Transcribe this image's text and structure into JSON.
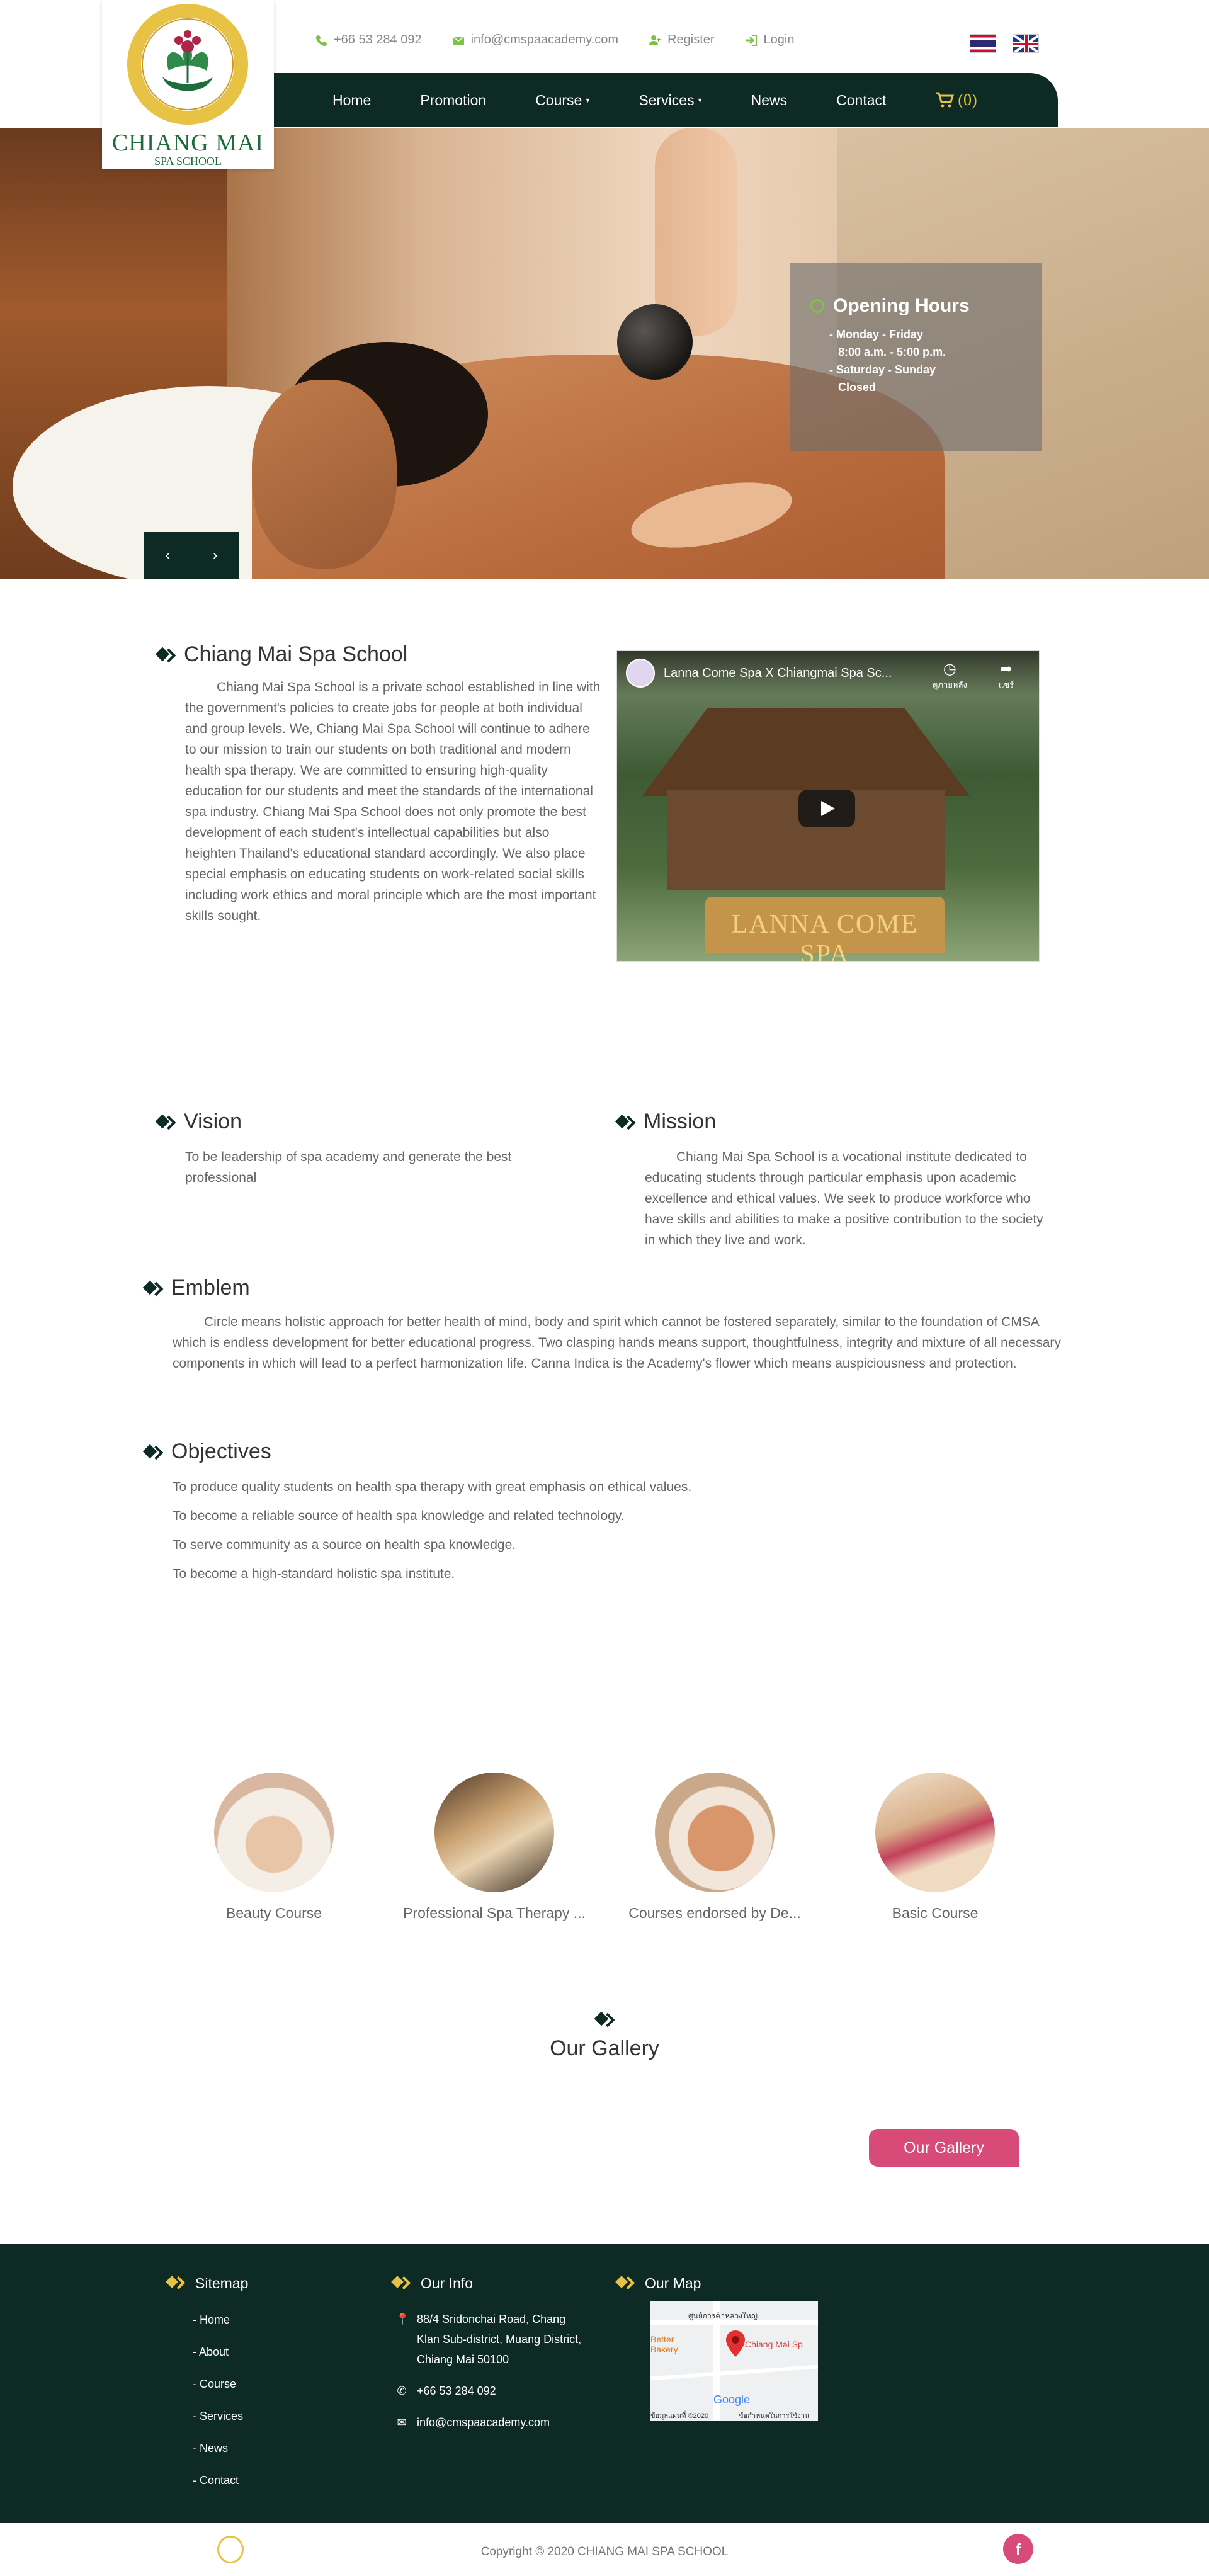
{
  "topbar": {
    "phone": "+66 53 284 092",
    "email": "info@cmspaacademy.com",
    "register": "Register",
    "login": "Login",
    "flags": [
      "thai-flag-icon",
      "uk-flag-icon"
    ]
  },
  "logo": {
    "arc_text": "โรงเรียนสปาเชียงใหม่ · CHIANG MAI SPA SCHOOL",
    "title": "CHIANG MAI",
    "subtitle": "SPA SCHOOL"
  },
  "nav": {
    "items": [
      {
        "label": "Home",
        "caret": false
      },
      {
        "label": "Promotion",
        "caret": false
      },
      {
        "label": "Course",
        "caret": true
      },
      {
        "label": "Services",
        "caret": true
      },
      {
        "label": "News",
        "caret": false
      },
      {
        "label": "Contact",
        "caret": false
      }
    ],
    "cart_count": "(0)"
  },
  "hero": {
    "hours_title": "Opening Hours",
    "hours": [
      "- Monday - Friday",
      "8:00 a.m. - 5:00 p.m.",
      "- Saturday - Sunday",
      "Closed"
    ],
    "prev": "‹",
    "next": "›"
  },
  "about": {
    "title": "Chiang Mai Spa School",
    "text": "Chiang Mai Spa School is a private school established in line with the government's policies to create jobs for people at both individual and group levels. We, Chiang Mai Spa School will continue to adhere to our mission to train our students on both traditional and modern health spa therapy. We are committed to ensuring high-quality education for our students and meet the standards of the international spa industry. Chiang Mai Spa School does not only promote the best development of each student's intellectual capabilities but also heighten Thailand's educational standard accordingly. We also place special emphasis on educating students on work-related social skills including work ethics and moral principle which are the most important skills sought.",
    "video_title": "Lanna Come Spa X Chiangmai Spa Sc...",
    "video_sign": "LANNA COME SPA",
    "video_watch_later": "ดูภายหลัง",
    "video_share": "แชร์"
  },
  "vision": {
    "title": "Vision",
    "text": "To be leadership of spa academy and generate the best professional"
  },
  "mission": {
    "title": "Mission",
    "text": "Chiang Mai Spa School is a vocational institute dedicated to educating students through particular emphasis upon academic excellence and ethical values. We seek to produce workforce who have skills and abilities to make a positive contribution to the society in which they live and work."
  },
  "emblem": {
    "title": "Emblem",
    "text": "Circle means holistic approach for better health of mind, body and spirit which cannot be fostered separately, similar to the foundation of CMSA which is endless development for better educational progress. Two clasping hands means support, thoughtfulness, integrity and mixture of all necessary components in which will lead to a perfect harmonization life. Canna Indica is the Academy's flower which means auspiciousness and protection."
  },
  "objectives": {
    "title": "Objectives",
    "items": [
      "To produce quality students on health spa therapy with great emphasis on ethical values.",
      "To become a reliable source of health spa knowledge and related technology.",
      "To serve community as a source on health spa knowledge.",
      "To become a high-standard holistic spa institute."
    ]
  },
  "courses": [
    {
      "label": "Beauty Course"
    },
    {
      "label": "Professional Spa Therapy ..."
    },
    {
      "label": "Courses endorsed by De..."
    },
    {
      "label": "Basic Course"
    }
  ],
  "gallery": {
    "title": "Our Gallery",
    "button": "Our Gallery"
  },
  "footer": {
    "sitemap_title": "Sitemap",
    "sitemap": [
      "- Home",
      "- About",
      "- Course",
      "- Services",
      "- News",
      "- Contact"
    ],
    "info_title": "Our Info",
    "address": "88/4 Sridonchai Road, Chang Klan Sub-district, Muang District, Chiang Mai 50100",
    "phone": "+66 53 284 092",
    "email": "info@cmspaacademy.com",
    "map_title": "Our Map",
    "map_labels": {
      "top": "ศูนย์การค้าหลวงใหญ่",
      "pin": "Chiang Mai Sp",
      "left": "Better Bakery",
      "google": "Google",
      "data": "ข้อมูลแผนที่ ©2020",
      "terms": "ข้อกำหนดในการใช้งาน"
    },
    "copyright": "Copyright © 2020 CHIANG MAI SPA SCHOOL",
    "facebook": "f"
  },
  "colors": {
    "dark_green": "#0e2a25",
    "pink": "#d84b79",
    "gold": "#e8c244",
    "logo_green": "#1e6b3c"
  }
}
